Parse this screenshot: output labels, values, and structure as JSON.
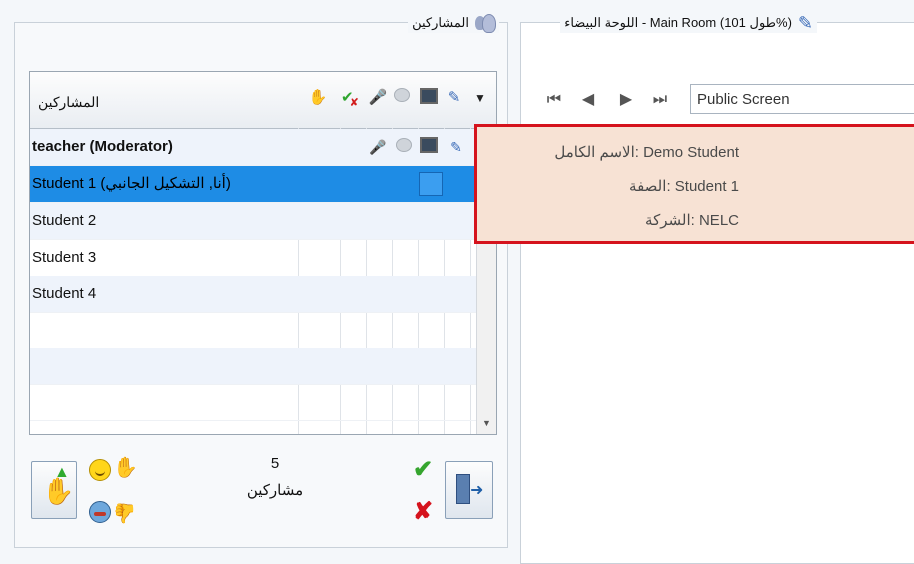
{
  "participants_panel": {
    "title": "المشاركين",
    "title_icon": "users-icon",
    "grid": {
      "name_header": "المشاركين",
      "column_icons": [
        "raise-hand-icon",
        "status-check-cross-icon",
        "microphone-icon",
        "chat-bubble-icon",
        "screen-icon",
        "pencil-icon",
        "dropdown-arrow-icon"
      ],
      "rows": [
        {
          "name": "teacher (Moderator)",
          "bold": true,
          "selected": false,
          "alt": true,
          "icons": [
            "microphone-icon",
            "chat-bubble-icon",
            "screen-icon",
            "pencil-icon"
          ]
        },
        {
          "name": "Student 1 (أنا, التشكيل الجانبي)",
          "bold": false,
          "selected": true,
          "alt": false,
          "icons": []
        },
        {
          "name": "Student 2",
          "bold": false,
          "selected": false,
          "alt": true,
          "icons": []
        },
        {
          "name": "Student 3",
          "bold": false,
          "selected": false,
          "alt": false,
          "icons": []
        },
        {
          "name": "Student 4",
          "bold": false,
          "selected": false,
          "alt": true,
          "icons": []
        }
      ]
    },
    "footer": {
      "count": "5",
      "count_label": "مشاركين",
      "buttons": [
        "raise-hand-button",
        "smile-emoticon",
        "applause-emoticon",
        "sad-emoticon",
        "thumbs-down-emoticon",
        "agree-check",
        "disagree-cross",
        "exit-button"
      ]
    }
  },
  "whiteboard_panel": {
    "title": "اللوحة البيضاء - Main Room (طول 101%)",
    "title_icon": "pencil-icon",
    "nav": [
      "first-page-icon",
      "prev-page-icon",
      "next-page-icon",
      "last-page-icon"
    ],
    "screen_field_value": "Public Screen"
  },
  "tooltip": {
    "lines": [
      "الاسم الكامل: Demo Student",
      "الصفة: Student 1",
      "الشركة: NELC"
    ]
  },
  "colors": {
    "selection": "#1e8ce5",
    "tooltip_border": "#d5131d",
    "tooltip_bg": "#f7e2d4"
  }
}
